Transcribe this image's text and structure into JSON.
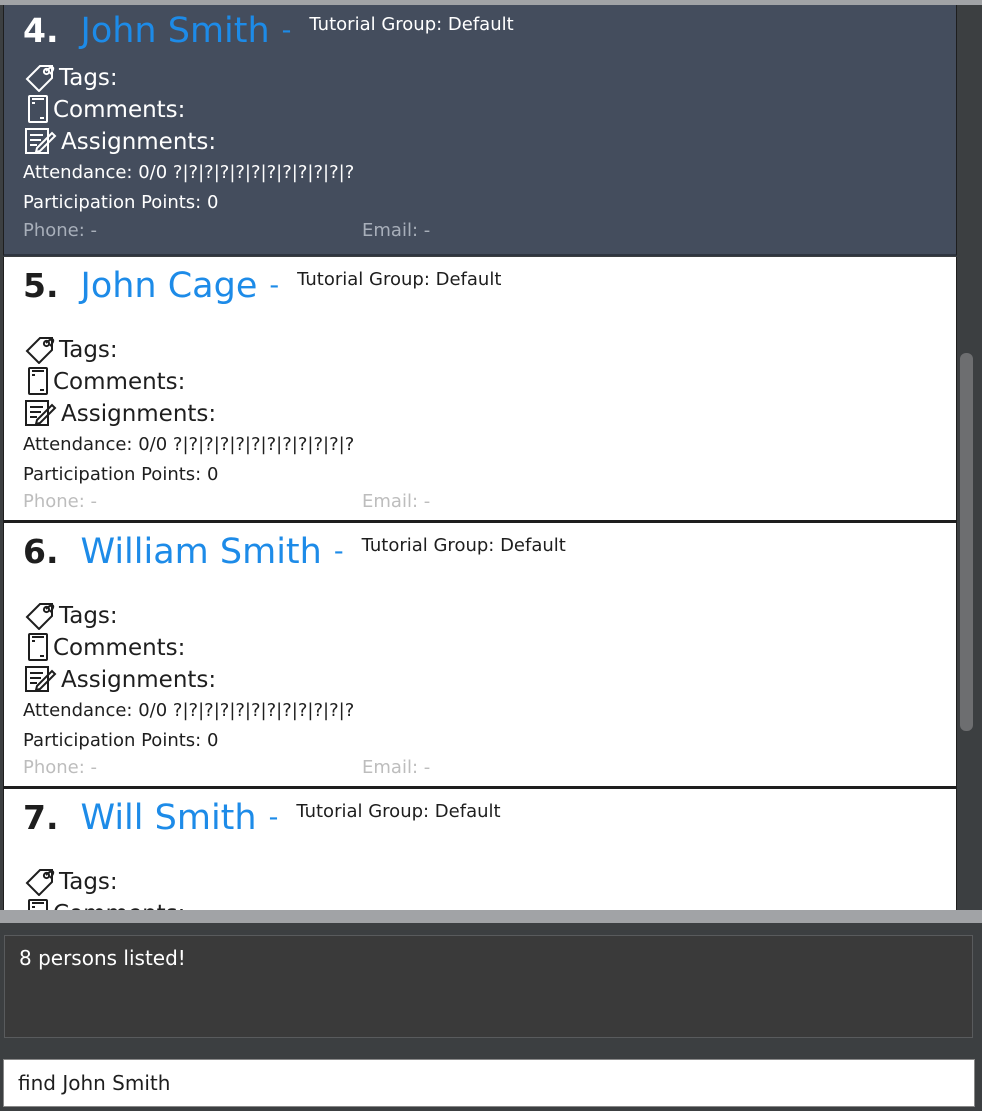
{
  "person_list": {
    "cards": [
      {
        "index": "4.",
        "name": "John Smith",
        "separator": "-",
        "tutorial_group": "Tutorial Group: Default",
        "tags_label": "Tags:",
        "comments_label": "Comments:",
        "assignments_label": "Assignments:",
        "attendance": "Attendance: 0/0  ?|?|?|?|?|?|?|?|?|?|?|?",
        "participation": "Participation Points: 0",
        "phone": "Phone:  -",
        "email": "Email:  -",
        "selected": true
      },
      {
        "index": "5.",
        "name": "John Cage",
        "separator": "-",
        "tutorial_group": "Tutorial Group: Default",
        "tags_label": "Tags:",
        "comments_label": "Comments:",
        "assignments_label": "Assignments:",
        "attendance": "Attendance: 0/0  ?|?|?|?|?|?|?|?|?|?|?|?",
        "participation": "Participation Points: 0",
        "phone": "Phone:  -",
        "email": "Email:  -",
        "selected": false
      },
      {
        "index": "6.",
        "name": "William Smith",
        "separator": "-",
        "tutorial_group": "Tutorial Group: Default",
        "tags_label": "Tags:",
        "comments_label": "Comments:",
        "assignments_label": "Assignments:",
        "attendance": "Attendance: 0/0  ?|?|?|?|?|?|?|?|?|?|?|?",
        "participation": "Participation Points: 0",
        "phone": "Phone:  -",
        "email": "Email:  -",
        "selected": false
      },
      {
        "index": "7.",
        "name": "Will Smith",
        "separator": "-",
        "tutorial_group": "Tutorial Group: Default",
        "tags_label": "Tags:",
        "comments_label": "Comments:",
        "selected": false
      }
    ]
  },
  "result_display": {
    "text": "8 persons listed!"
  },
  "command_box": {
    "value": "find John Smith"
  },
  "icons": {
    "tags": "tag-icon",
    "comments": "notepad-icon",
    "assignments": "assignment-icon"
  },
  "colors": {
    "name": "#1d8be8",
    "selected_card": "#444d5d",
    "result_background": "#3a3a3a"
  }
}
